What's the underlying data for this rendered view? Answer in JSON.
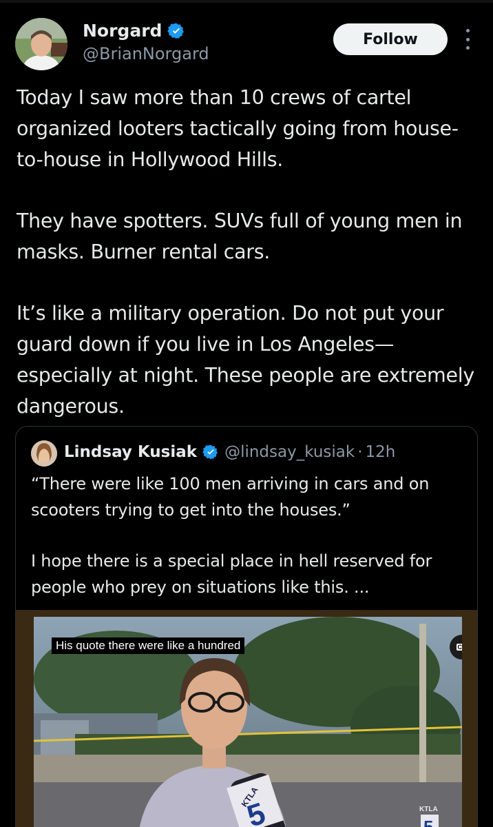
{
  "post": {
    "author_name": "Norgard",
    "handle": "@BrianNorgard",
    "follow_label": "Follow",
    "paragraphs": [
      "Today I saw more than 10 crews of cartel organized looters tactically going from house-to-house in Hollywood Hills.",
      "They have spotters. SUVs full of young men in masks. Burner rental cars.",
      "It’s like a military operation. Do not put your guard down if you live in Los Angeles—especially at night. These people are extremely dangerous."
    ]
  },
  "quoted": {
    "author_name": "Lindsay Kusiak",
    "handle": "@lindsay_kusiak",
    "separator": "·",
    "time": "12h",
    "paragraphs": [
      "“There were like 100 men arriving in cars and on scooters trying to get into the houses.”",
      "I hope there is a special place in hell reserved for people who prey on situations like this. ..."
    ],
    "video": {
      "caption": "His quote there were like a hundred",
      "cc_label": "CC",
      "mic_logo": "KTLA",
      "corner_logo": "KTLA",
      "channel_number": "5"
    }
  },
  "colors": {
    "background": "#000000",
    "text": "#e7e9ea",
    "secondary": "#8b98a5",
    "verified": "#1d9bf0",
    "border": "#2f3336"
  }
}
